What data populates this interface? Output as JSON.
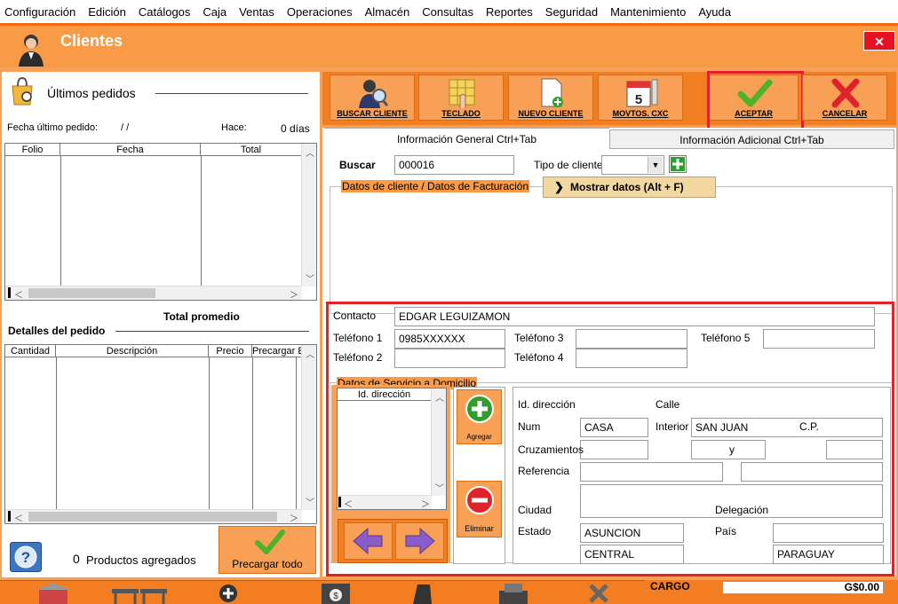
{
  "menu": [
    "Configuración",
    "Edición",
    "Catálogos",
    "Caja",
    "Ventas",
    "Operaciones",
    "Almacén",
    "Consultas",
    "Reportes",
    "Seguridad",
    "Mantenimiento",
    "Ayuda"
  ],
  "window": {
    "title": "Clientes",
    "close": "✕"
  },
  "left": {
    "last_orders_title": "Últimos pedidos",
    "last_order_date_label": "Fecha último pedido:",
    "last_order_date_value": "/ /",
    "ago_label": "Hace:",
    "ago_value": "0 días",
    "orders_columns": [
      "Folio",
      "Fecha",
      "Total"
    ],
    "total_avg_label": "Total promedio",
    "details_title": "Detalles del pedido",
    "details_columns": [
      "Cantidad",
      "Descripción",
      "Precio",
      "Precargar E"
    ],
    "products_count": "0",
    "products_label": "Productos agregados",
    "preload_all_label": "Precargar todo"
  },
  "toolbar": {
    "buscar": "BUSCAR CLIENTE",
    "teclado": "TECLADO",
    "nuevo": "NUEVO CLIENTE",
    "movtos": "MOVTOS. CXC",
    "aceptar": "ACEPTAR",
    "cancelar": "CANCELAR"
  },
  "tabs": {
    "general": "Información General Ctrl+Tab",
    "adicional": "Información Adicional Ctrl+Tab"
  },
  "form": {
    "buscar_label": "Buscar",
    "buscar_value": "000016",
    "tipo_label": "Tipo de cliente",
    "datos_legend": "Datos de cliente / Datos de Facturación",
    "mostrar_label": "Mostrar datos (Alt + F)",
    "contacto_label": "Contacto",
    "contacto_value": "EDGAR LEGUIZAMON",
    "tel1_label": "Teléfono 1",
    "tel1_value": "0985XXXXXX",
    "tel2_label": "Teléfono 2",
    "tel3_label": "Teléfono 3",
    "tel4_label": "Teléfono 4",
    "tel5_label": "Teléfono 5",
    "domicilio_legend": "Datos de Servicio a Domicilio",
    "id_dir_col": "Id. dirección",
    "agregar": "Agregar",
    "eliminar": "Eliminar",
    "id_dir_label": "Id. dirección",
    "id_dir_value": "CASA",
    "calle_label": "Calle",
    "calle_value": "SAN JUAN",
    "num_label": "Num",
    "interior_label": "Interior",
    "cp_label": "C.P.",
    "cruz_label": "Cruzamientos",
    "y_label": "y",
    "ref_label": "Referencia",
    "ciudad_label": "Ciudad",
    "ciudad_value": "ASUNCION",
    "deleg_label": "Delegación",
    "estado_label": "Estado",
    "estado_value": "CENTRAL",
    "pais_label": "País",
    "pais_value": "PARAGUAY"
  },
  "bottom": {
    "cargo_label": "CARGO",
    "cargo_value": "G$0.00"
  },
  "colors": {
    "orange": "#f27e21",
    "orange_light": "#f8a055",
    "red_highlight": "#e0232b"
  }
}
